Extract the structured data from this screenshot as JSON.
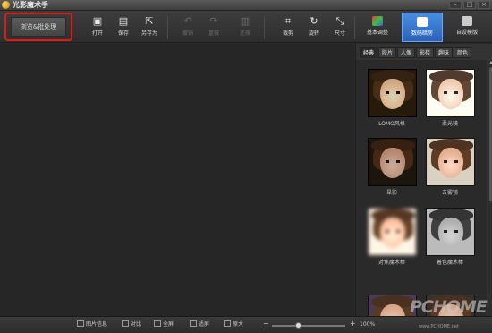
{
  "app": {
    "title": "光影魔术手"
  },
  "window": {
    "min": "–",
    "max": "□",
    "close": "×"
  },
  "toolbar": {
    "browse_label": "浏览&批处理",
    "tools": [
      {
        "id": "open",
        "label": "打开",
        "icon": "▣",
        "enabled": true
      },
      {
        "id": "save",
        "label": "保存",
        "icon": "▤",
        "enabled": true
      },
      {
        "id": "saveas",
        "label": "另存为",
        "icon": "⇱",
        "enabled": true
      },
      {
        "id": "undo",
        "label": "撤销",
        "icon": "↶",
        "enabled": false
      },
      {
        "id": "redo",
        "label": "重做",
        "icon": "↷",
        "enabled": false
      },
      {
        "id": "restore",
        "label": "还原",
        "icon": "▥",
        "enabled": false
      },
      {
        "id": "crop",
        "label": "裁剪",
        "icon": "⌗",
        "enabled": true
      },
      {
        "id": "rotate",
        "label": "旋转",
        "icon": "↻",
        "enabled": true
      },
      {
        "id": "size",
        "label": "尺寸",
        "icon": "⤡",
        "enabled": true
      }
    ],
    "tabs": [
      {
        "id": "basic",
        "label": "基本调整",
        "active": false
      },
      {
        "id": "darkroom",
        "label": "数码暗房",
        "active": true
      },
      {
        "id": "template",
        "label": "自设模版",
        "active": false
      }
    ]
  },
  "panel": {
    "subtabs": [
      "经典",
      "胶片",
      "人像",
      "影楼",
      "趣味",
      "颜色"
    ],
    "active_subtab": "经典",
    "effects": [
      "LOMO风格",
      "柔光镜",
      "晕影",
      "去雾镜",
      "对焦魔术棒",
      "着色魔术棒"
    ]
  },
  "statusbar": {
    "items": [
      "图片信息",
      "对比",
      "全屏",
      "适屏",
      "原大"
    ],
    "zoom_minus": "−",
    "zoom_plus": "+",
    "zoom": "100%",
    "zoom_fraction": 0.35
  },
  "watermark": {
    "big": "PCHOME",
    "small": "www.PCHOME.net"
  }
}
